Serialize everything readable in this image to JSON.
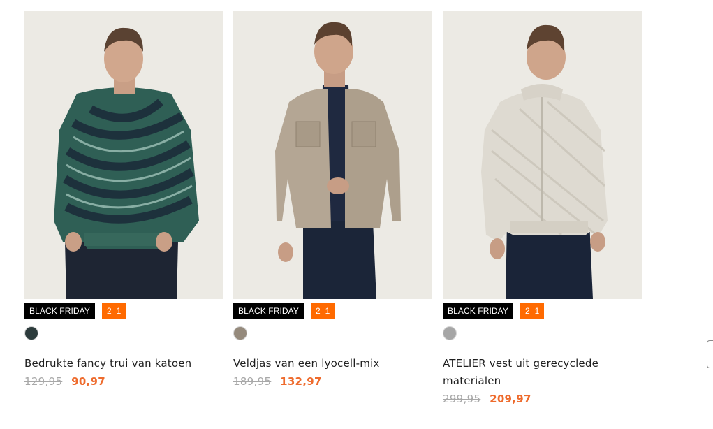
{
  "products": [
    {
      "badge_black_friday": "BLACK FRIDAY",
      "badge_promo": "2=1",
      "swatch_color": "#2c3b3c",
      "title": "Bedrukte fancy trui van katoen",
      "old_price": "129,95",
      "new_price": "90,97",
      "garment_color": "#2f5f55"
    },
    {
      "badge_black_friday": "BLACK FRIDAY",
      "badge_promo": "2=1",
      "swatch_color": "#958a7c",
      "title": "Veldjas van een lyocell-mix",
      "old_price": "189,95",
      "new_price": "132,97",
      "garment_color": "#b4a694"
    },
    {
      "badge_black_friday": "BLACK FRIDAY",
      "badge_promo": "2=1",
      "swatch_color": "#a6a6a6",
      "title_line1": "ATELIER vest uit gerecyclede",
      "title_line2": "materialen",
      "old_price": "299,95",
      "new_price": "209,97",
      "garment_color": "#dedad1"
    }
  ],
  "colors": {
    "accent_orange": "#ff6a00",
    "sale_price": "#ee6b2d",
    "badge_black": "#000000"
  }
}
